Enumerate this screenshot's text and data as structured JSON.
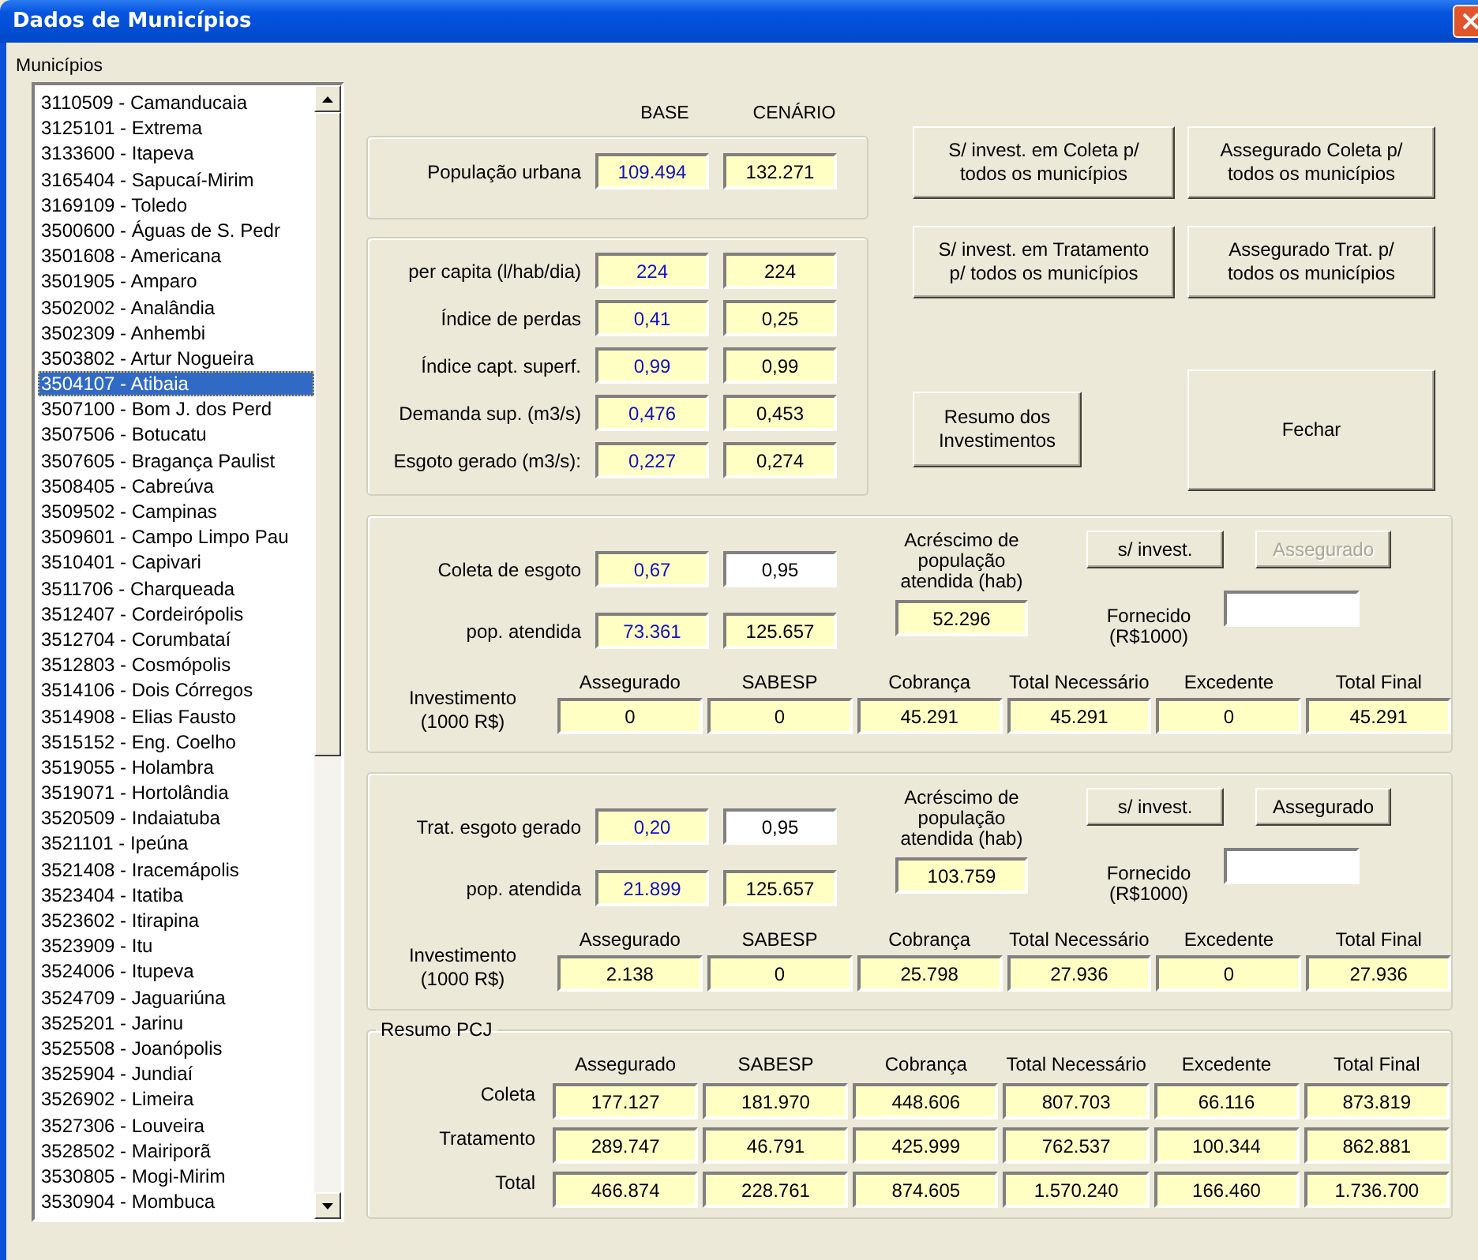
{
  "window": {
    "title": "Dados de Municípios"
  },
  "municipios": {
    "label": "Municípios",
    "items": [
      {
        "text": "3110509 - Camanducaia",
        "selected": false
      },
      {
        "text": "3125101 - Extrema",
        "selected": false
      },
      {
        "text": "3133600 - Itapeva",
        "selected": false
      },
      {
        "text": "3165404 - Sapucaí-Mirim",
        "selected": false
      },
      {
        "text": "3169109 - Toledo",
        "selected": false
      },
      {
        "text": "3500600 - Águas de S. Pedr",
        "selected": false
      },
      {
        "text": "3501608 - Americana",
        "selected": false
      },
      {
        "text": "3501905 - Amparo",
        "selected": false
      },
      {
        "text": "3502002 - Analândia",
        "selected": false
      },
      {
        "text": "3502309 - Anhembi",
        "selected": false
      },
      {
        "text": "3503802 - Artur Nogueira",
        "selected": false
      },
      {
        "text": "3504107 - Atibaia",
        "selected": true
      },
      {
        "text": "3507100 - Bom J. dos Perd",
        "selected": false
      },
      {
        "text": "3507506 - Botucatu",
        "selected": false
      },
      {
        "text": "3507605 - Bragança Paulist",
        "selected": false
      },
      {
        "text": "3508405 - Cabreúva",
        "selected": false
      },
      {
        "text": "3509502 - Campinas",
        "selected": false
      },
      {
        "text": "3509601 - Campo Limpo Pau",
        "selected": false
      },
      {
        "text": "3510401 - Capivari",
        "selected": false
      },
      {
        "text": "3511706 - Charqueada",
        "selected": false
      },
      {
        "text": "3512407 - Cordeirópolis",
        "selected": false
      },
      {
        "text": "3512704 - Corumbataí",
        "selected": false
      },
      {
        "text": "3512803 - Cosmópolis",
        "selected": false
      },
      {
        "text": "3514106 - Dois Córregos",
        "selected": false
      },
      {
        "text": "3514908 - Elias Fausto",
        "selected": false
      },
      {
        "text": "3515152 - Eng. Coelho",
        "selected": false
      },
      {
        "text": "3519055 - Holambra",
        "selected": false
      },
      {
        "text": "3519071 - Hortolândia",
        "selected": false
      },
      {
        "text": "3520509 - Indaiatuba",
        "selected": false
      },
      {
        "text": "3521101 - Ipeúna",
        "selected": false
      },
      {
        "text": "3521408 - Iracemápolis",
        "selected": false
      },
      {
        "text": "3523404 - Itatiba",
        "selected": false
      },
      {
        "text": "3523602 - Itirapina",
        "selected": false
      },
      {
        "text": "3523909 - Itu",
        "selected": false
      },
      {
        "text": "3524006 - Itupeva",
        "selected": false
      },
      {
        "text": "3524709 - Jaguariúna",
        "selected": false
      },
      {
        "text": "3525201 - Jarinu",
        "selected": false
      },
      {
        "text": "3525508 - Joanópolis",
        "selected": false
      },
      {
        "text": "3525904 - Jundiaí",
        "selected": false
      },
      {
        "text": "3526902 - Limeira",
        "selected": false
      },
      {
        "text": "3527306 - Louveira",
        "selected": false
      },
      {
        "text": "3528502 - Mairiporã",
        "selected": false
      },
      {
        "text": "3530805 - Mogi-Mirim",
        "selected": false
      },
      {
        "text": "3530904 - Mombuca",
        "selected": false
      }
    ]
  },
  "columns": [
    "BASE",
    "CENÁRIO"
  ],
  "populacao": {
    "label": "População urbana",
    "base": "109.494",
    "cenario": "132.271"
  },
  "parametros": [
    {
      "label": "per capita (l/hab/dia)",
      "base": "224",
      "cenario": "224"
    },
    {
      "label": "Índice de perdas",
      "base": "0,41",
      "cenario": "0,25"
    },
    {
      "label": "Índice capt. superf.",
      "base": "0,99",
      "cenario": "0,99"
    },
    {
      "label": "Demanda sup. (m3/s)",
      "base": "0,476",
      "cenario": "0,453"
    },
    {
      "label": "Esgoto gerado (m3/s):",
      "base": "0,227",
      "cenario": "0,274"
    }
  ],
  "actions": [
    {
      "label": "S/ invest. em Coleta p/\ntodos os municípios",
      "kind": "normal"
    },
    {
      "label": "Assegurado Coleta p/\ntodos os municípios",
      "kind": "normal"
    },
    {
      "label": "S/ invest. em Tratamento\np/ todos os municípios",
      "kind": "normal"
    },
    {
      "label": "Assegurado Trat. p/\ntodos os municípios",
      "kind": "normal"
    },
    {
      "label": "Resumo dos\nInvestimentos",
      "kind": "small"
    },
    {
      "label": "Fechar",
      "kind": "large"
    }
  ],
  "sections": [
    {
      "rows": [
        {
          "label": "Coleta de esgoto",
          "base": "0,67",
          "cenario": "0,95",
          "cenario_editable": true
        },
        {
          "label": "pop. atendida",
          "base": "73.361",
          "cenario": "125.657",
          "cenario_editable": false
        }
      ],
      "acrescimo": {
        "label": "Acréscimo de\npopulação\natendida (hab)",
        "value": "52.296"
      },
      "buttons": [
        {
          "label": "s/ invest.",
          "disabled": false
        },
        {
          "label": "Assegurado",
          "disabled": true
        }
      ],
      "fornecido": {
        "label": "Fornecido\n(R$1000)"
      },
      "investimento": {
        "label": "Investimento\n(1000 R$)",
        "columns": [
          "Assegurado",
          "SABESP",
          "Cobrança",
          "Total Necessário",
          "Excedente",
          "Total Final"
        ],
        "values": [
          "0",
          "0",
          "45.291",
          "45.291",
          "0",
          "45.291"
        ]
      }
    },
    {
      "rows": [
        {
          "label": "Trat. esgoto gerado",
          "base": "0,20",
          "cenario": "0,95",
          "cenario_editable": true
        },
        {
          "label": "pop. atendida",
          "base": "21.899",
          "cenario": "125.657",
          "cenario_editable": false
        }
      ],
      "acrescimo": {
        "label": "Acréscimo de\npopulação\natendida (hab)",
        "value": "103.759"
      },
      "buttons": [
        {
          "label": "s/ invest.",
          "disabled": false
        },
        {
          "label": "Assegurado",
          "disabled": false
        }
      ],
      "fornecido": {
        "label": "Fornecido\n(R$1000)"
      },
      "investimento": {
        "label": "Investimento\n(1000 R$)",
        "columns": [
          "Assegurado",
          "SABESP",
          "Cobrança",
          "Total Necessário",
          "Excedente",
          "Total Final"
        ],
        "values": [
          "2.138",
          "0",
          "25.798",
          "27.936",
          "0",
          "27.936"
        ]
      }
    }
  ],
  "resumo": {
    "title": "Resumo PCJ",
    "columns": [
      "Assegurado",
      "SABESP",
      "Cobrança",
      "Total Necessário",
      "Excedente",
      "Total Final"
    ],
    "rows": [
      {
        "label": "Coleta",
        "values": [
          "177.127",
          "181.970",
          "448.606",
          "807.703",
          "66.116",
          "873.819"
        ]
      },
      {
        "label": "Tratamento",
        "values": [
          "289.747",
          "46.791",
          "425.999",
          "762.537",
          "100.344",
          "862.881"
        ]
      },
      {
        "label": "Total",
        "values": [
          "466.874",
          "228.761",
          "874.605",
          "1.570.240",
          "166.460",
          "1.736.700"
        ]
      }
    ]
  }
}
